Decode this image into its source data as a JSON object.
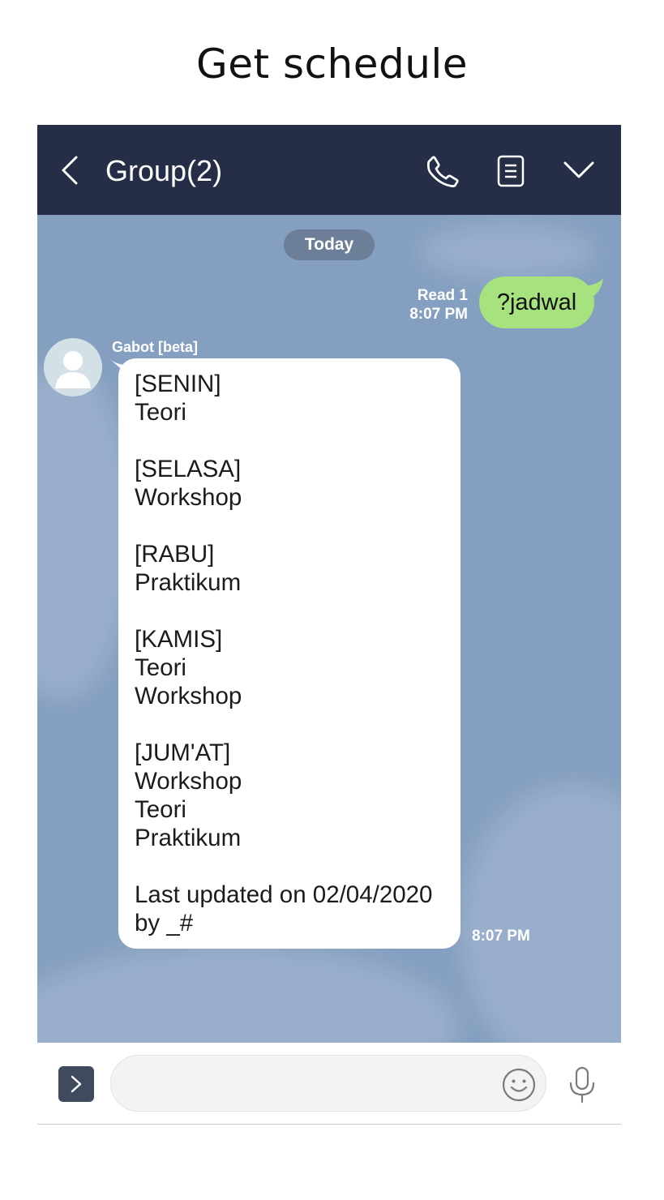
{
  "page": {
    "title": "Get schedule"
  },
  "header": {
    "title": "Group(2)",
    "icons": {
      "back": "chevron-left-icon",
      "call": "phone-icon",
      "notes": "note-icon",
      "expand": "chevron-down-icon"
    }
  },
  "chat": {
    "date_label": "Today",
    "sent_message": {
      "text": "?jadwal",
      "read_label": "Read 1",
      "time": "8:07 PM",
      "color": "#a6e27e"
    },
    "received_message": {
      "sender": "Gabot [beta]",
      "text": "[SENIN]\nTeori\n\n[SELASA]\nWorkshop\n\n[RABU]\nPraktikum\n\n[KAMIS]\nTeori\nWorkshop\n\n[JUM'AT]\nWorkshop\nTeori\nPraktikum\n\nLast updated on 02/04/2020\nby _#",
      "time": "8:07 PM"
    },
    "background_color": "#859fc0"
  },
  "input_bar": {
    "placeholder": "",
    "icons": {
      "menu": "chevron-right-icon",
      "emoji": "smiley-icon",
      "mic": "microphone-icon"
    }
  },
  "colors": {
    "header": "#252d47",
    "accent": "#a6e27e"
  }
}
